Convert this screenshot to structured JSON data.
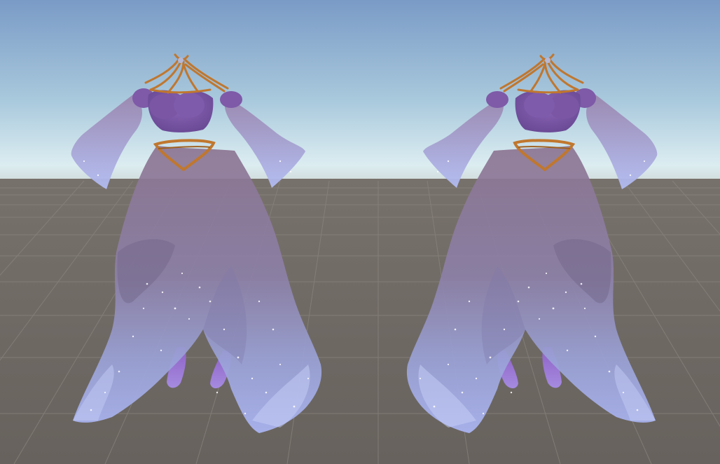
{
  "scene": {
    "description_type": "3d-viewport-render",
    "colors": {
      "sky_top": "#7f9fc8",
      "sky_horizon": "#d8ecf2",
      "ground": "#6b6661",
      "grid_line": "#8a8580",
      "bodice": "#7e5aa8",
      "skirt_top": "#8a7590",
      "skirt_bottom": "#a7b0ec",
      "sleeve": "#a9b3ee",
      "gold": "#c0772e",
      "shoe": "#9166c8",
      "sparkle": "#ffffff"
    },
    "models": [
      {
        "name": "dress-model-left"
      },
      {
        "name": "dress-model-right"
      }
    ]
  }
}
